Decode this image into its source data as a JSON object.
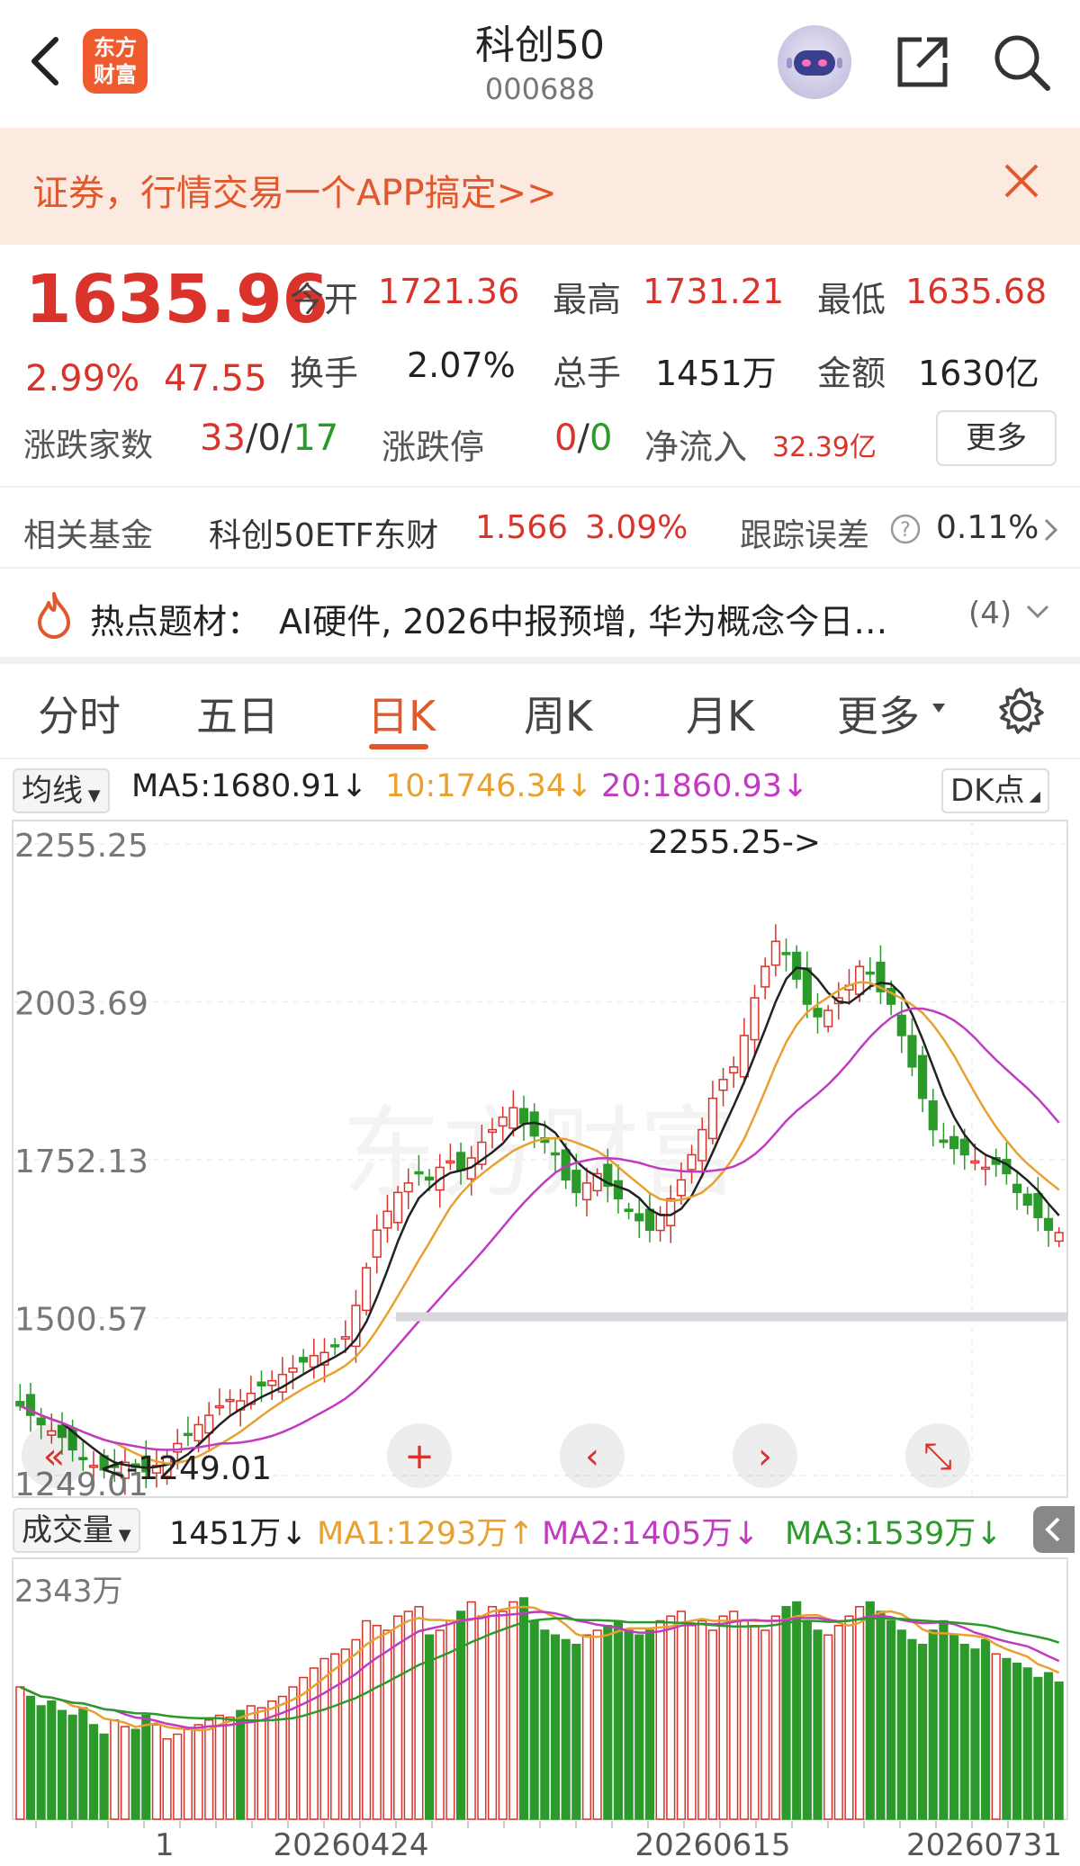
{
  "header": {
    "title": "科创50",
    "code": "000688",
    "logo_line1": "东方",
    "logo_line2": "财富"
  },
  "banner": {
    "text": "证券，行情交易一个APP搞定>>"
  },
  "quote": {
    "price": "1635.96",
    "pct": "2.99%",
    "change": "47.55",
    "open_label": "今开",
    "open": "1721.36",
    "high_label": "最高",
    "high": "1731.21",
    "low_label": "最低",
    "low": "1635.68",
    "turnover_label": "换手",
    "turnover": "2.07%",
    "volume_label": "总手",
    "volume": "1451万",
    "amount_label": "金额",
    "amount": "1630亿",
    "breadth_label": "涨跌家数",
    "breadth_up": "33",
    "breadth_flat": "0",
    "breadth_down": "17",
    "sep": "/",
    "limit_label": "涨跌停",
    "limit_up": "0",
    "limit_down": "0",
    "inflow_label": "净流入",
    "inflow": "32.39亿",
    "more": "更多"
  },
  "fund": {
    "label": "相关基金",
    "name": "科创50ETF东财",
    "price": "1.566",
    "pct": "3.09%",
    "track_label": "跟踪误差",
    "track_value": "0.11%"
  },
  "hot": {
    "label": "热点题材：",
    "text": "AI硬件, 2026中报预增, 华为概念今日…",
    "count": "(4)"
  },
  "tabs": [
    "分时",
    "五日",
    "日K",
    "周K",
    "月K",
    "更多"
  ],
  "ma_bar": {
    "selector": "均线",
    "ma5": "MA5:1680.91",
    "ma10": "10:1746.34",
    "ma20": "20:1860.93",
    "dk": "DK点",
    "colors": {
      "ma5": "#222222",
      "ma10": "#e8a030",
      "ma20": "#c23ac2"
    }
  },
  "vol_bar": {
    "selector": "成交量",
    "vol": "1451万",
    "ma1": "MA1:1293万",
    "ma2": "MA2:1405万",
    "ma3": "MA3:1539万"
  },
  "chart_data": {
    "type": "candlestick",
    "price_axis_labels": [
      "2255.25",
      "2003.69",
      "1752.13",
      "1500.57",
      "1249.01"
    ],
    "price_range": [
      1249.01,
      2255.25
    ],
    "max_annotation": "2255.25->",
    "min_annotation": "<-1249.01",
    "volume_axis_label": "2343万",
    "x_labels": [
      "20260424",
      "20260615",
      "20260731"
    ],
    "x_label_left_fragment": "1",
    "closes": [
      1360,
      1345,
      1330,
      1320,
      1310,
      1290,
      1275,
      1265,
      1258,
      1262,
      1270,
      1262,
      1255,
      1265,
      1280,
      1300,
      1315,
      1330,
      1345,
      1360,
      1370,
      1368,
      1380,
      1392,
      1400,
      1410,
      1420,
      1430,
      1440,
      1445,
      1455,
      1470,
      1520,
      1580,
      1640,
      1670,
      1700,
      1715,
      1730,
      1720,
      1740,
      1750,
      1735,
      1755,
      1780,
      1800,
      1820,
      1835,
      1810,
      1790,
      1780,
      1760,
      1720,
      1700,
      1715,
      1730,
      1710,
      1690,
      1670,
      1655,
      1640,
      1665,
      1690,
      1720,
      1760,
      1800,
      1850,
      1880,
      1900,
      1950,
      2010,
      2060,
      2100,
      2080,
      2040,
      2000,
      1980,
      1990,
      2010,
      2030,
      2060,
      2050,
      2020,
      2000,
      1950,
      1900,
      1850,
      1800,
      1780,
      1770,
      1760,
      1750,
      1740,
      1745,
      1730,
      1700,
      1680,
      1660,
      1640,
      1636
    ],
    "volumes": [
      1400,
      1300,
      1200,
      1250,
      1150,
      1100,
      1180,
      1000,
      900,
      1050,
      980,
      950,
      1100,
      1000,
      850,
      900,
      950,
      1000,
      1050,
      1100,
      1080,
      1150,
      1200,
      1180,
      1250,
      1300,
      1400,
      1500,
      1600,
      1700,
      1750,
      1800,
      1900,
      2100,
      2050,
      2000,
      2150,
      2200,
      2250,
      1950,
      2000,
      2100,
      2200,
      2300,
      2150,
      2250,
      2200,
      2300,
      2343,
      2100,
      2000,
      1950,
      1900,
      1850,
      1950,
      2000,
      2050,
      2100,
      2000,
      1950,
      2000,
      2100,
      2150,
      2200,
      2050,
      2100,
      2000,
      2150,
      2200,
      2100,
      2050,
      2000,
      2150,
      2250,
      2300,
      2100,
      2000,
      1950,
      2050,
      2150,
      2250,
      2300,
      2200,
      2100,
      2000,
      1900,
      1850,
      2000,
      2100,
      1950,
      1850,
      1800,
      1900,
      1750,
      1700,
      1650,
      1600,
      1500,
      1550,
      1451
    ],
    "ma_lines": [
      "MA5",
      "MA10",
      "MA20"
    ]
  }
}
